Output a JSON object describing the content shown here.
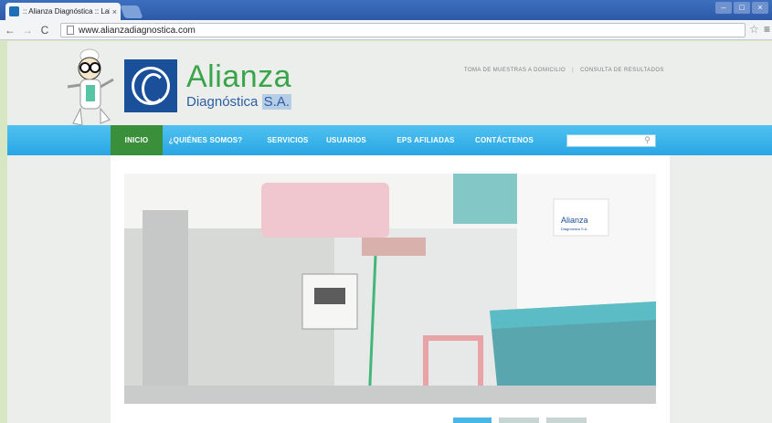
{
  "browser": {
    "tab_title": ":: Alianza Diagnóstica :: Lab",
    "tab_close": "×",
    "url": "www.alianzadiagnostica.com",
    "back": "←",
    "forward": "→",
    "reload": "C",
    "star": "☆",
    "menu": "≡",
    "win_min": "–",
    "win_max": "□",
    "win_close": "×"
  },
  "header": {
    "brand_name": "Alianza",
    "brand_sub_text": "Diagnóstica",
    "brand_sub_sa": "S.A.",
    "toplinks": [
      "TOMA DE MUESTRAS A DOMICILIO",
      "CONSULTA DE RESULTADOS"
    ],
    "toplinks_sep": "|"
  },
  "nav": {
    "items": [
      {
        "label": "INICIO",
        "active": true
      },
      {
        "label": "¿QUIÉNES SOMOS?",
        "active": false
      },
      {
        "label": "SERVICIOS",
        "active": false
      },
      {
        "label": "USUARIOS",
        "active": false
      },
      {
        "label": "EPS AFILIADAS",
        "active": false
      },
      {
        "label": "CONTÁCTENOS",
        "active": false
      }
    ],
    "search_icon": "⚲"
  },
  "hero": {
    "lab_coat_brand": "Alianza",
    "lab_coat_sub": "Diagnóstica S.A."
  },
  "colors": {
    "nav_blue": "#2aa6e4",
    "nav_active": "#3a8f3b",
    "brand_green": "#39a54a",
    "brand_blue": "#2b5da2"
  }
}
